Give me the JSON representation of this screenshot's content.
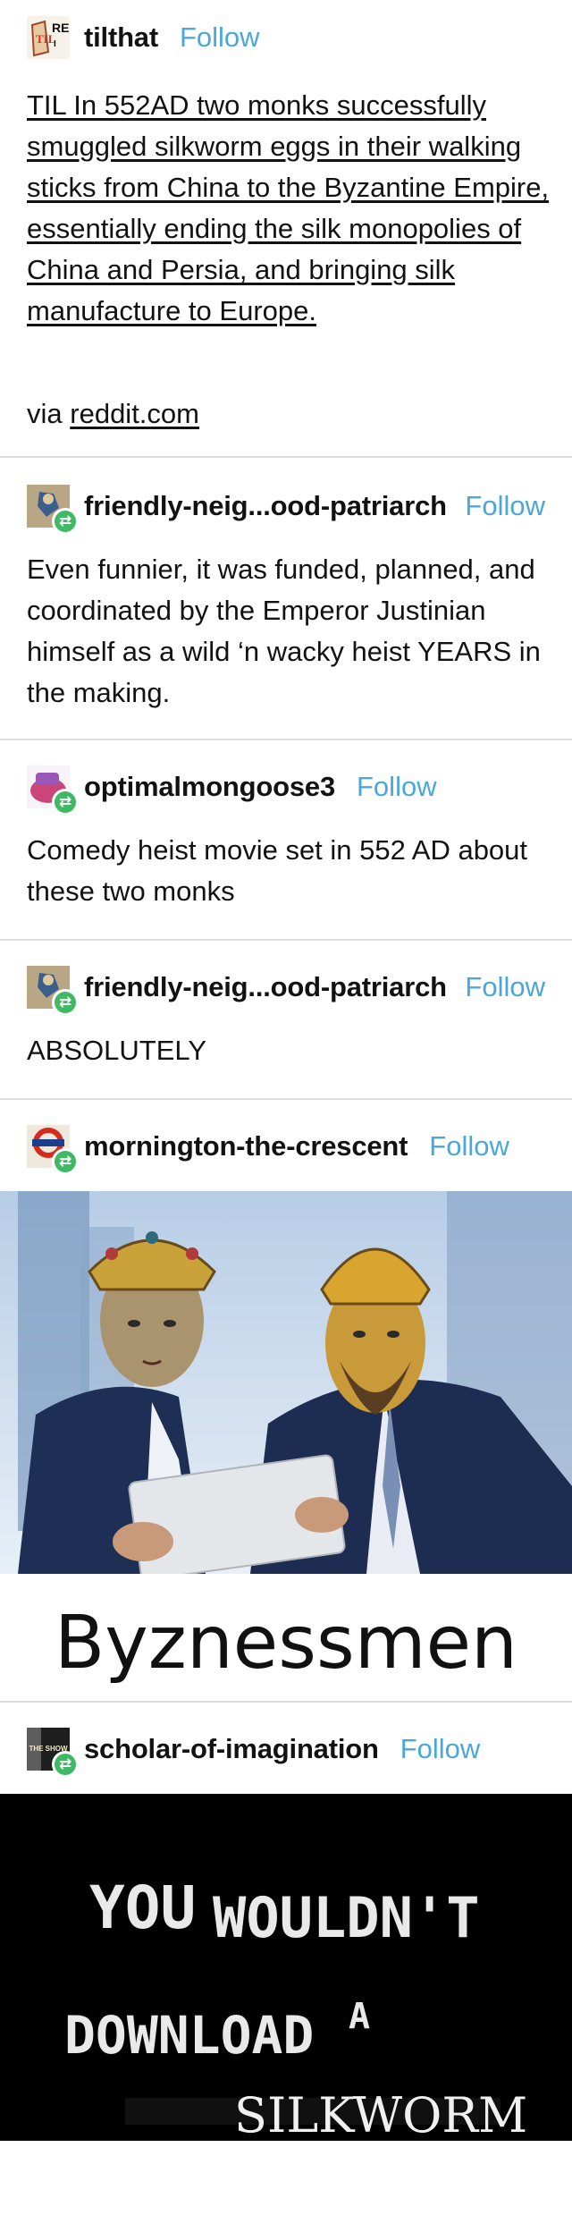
{
  "posts": [
    {
      "username": "tilthat",
      "follow_label": "Follow",
      "title": "TIL In 552AD two monks successfully smuggled silkworm eggs in their walking sticks from China to the Byzantine Empire, essentially ending the silk monopolies of China and Persia, and bringing silk manufacture to Europe.",
      "via_prefix": "via",
      "via_link": "reddit.com",
      "avatar_text": "REI TIL"
    },
    {
      "username": "friendly-neig...ood-patriarch",
      "follow_label": "Follow",
      "text": "Even funnier, it was funded, planned, and coordinated by the Emperor Justinian himself as a wild ‘n wacky heist YEARS in the making."
    },
    {
      "username": "optimalmongoose3",
      "follow_label": "Follow",
      "text": "Comedy heist movie set in 552 AD about these two monks"
    },
    {
      "username": "friendly-neig...ood-patriarch",
      "follow_label": "Follow",
      "text": "ABSOLUTELY"
    },
    {
      "username": "mornington-the-crescent",
      "follow_label": "Follow",
      "image_caption": "Byznessmen"
    },
    {
      "username": "scholar-of-imagination",
      "follow_label": "Follow",
      "avatar_text": "THE SHOW",
      "image_text_line1a": "YOU",
      "image_text_line1b": "WOULDN'T",
      "image_text_line2a": "DOWNLOAD",
      "image_text_line2b": "A",
      "image_text_line3": "SILKWORM"
    }
  ],
  "icons": {
    "reblog": "reblog-icon"
  },
  "colors": {
    "follow": "#4aa8d8",
    "reblog_badge": "#3fb964",
    "divider": "#dcdcdc"
  }
}
